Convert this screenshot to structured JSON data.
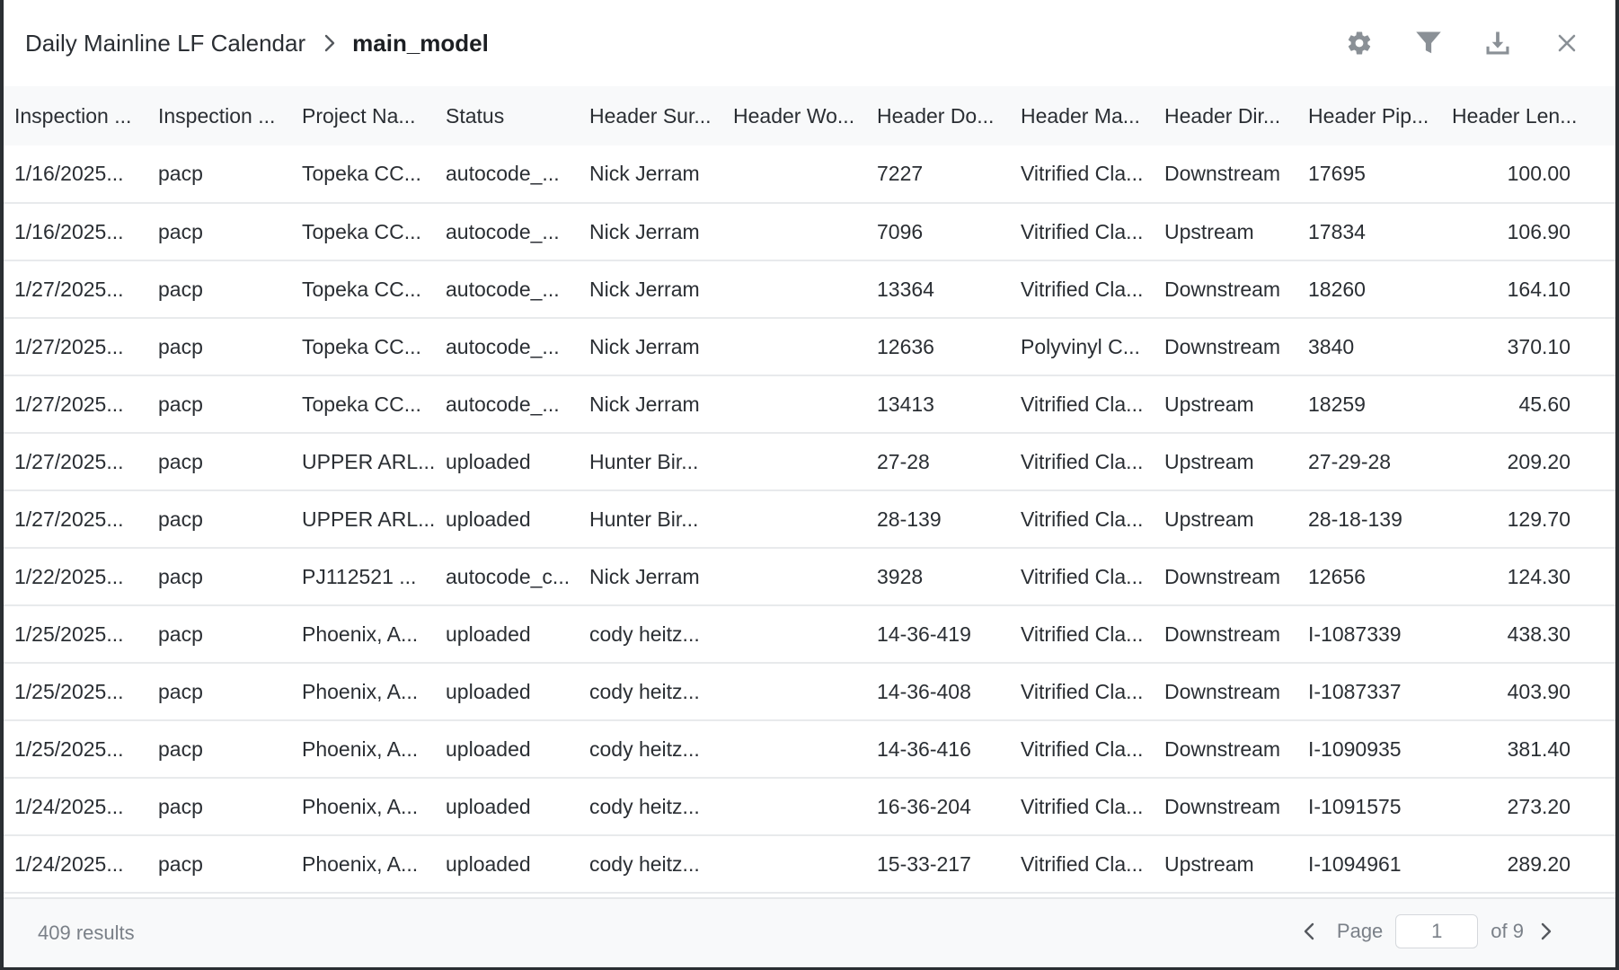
{
  "breadcrumb": {
    "parent": "Daily Mainline LF Calendar",
    "current": "main_model"
  },
  "icons": {
    "settings": "gear-icon",
    "filter": "filter-icon",
    "download": "download-icon",
    "close": "close-icon"
  },
  "table": {
    "columns": [
      "Inspection ...",
      "Inspection ...",
      "Project Na...",
      "Status",
      "Header Sur...",
      "Header Wo...",
      "Header Do...",
      "Header Ma...",
      "Header Dir...",
      "Header Pip...",
      "Header Len..."
    ],
    "rows": [
      [
        "1/16/2025...",
        "pacp",
        "Topeka CC...",
        "autocode_...",
        "Nick Jerram",
        "",
        "7227",
        "Vitrified Cla...",
        "Downstream",
        "17695",
        "100.00"
      ],
      [
        "1/16/2025...",
        "pacp",
        "Topeka CC...",
        "autocode_...",
        "Nick Jerram",
        "",
        "7096",
        "Vitrified Cla...",
        "Upstream",
        "17834",
        "106.90"
      ],
      [
        "1/27/2025...",
        "pacp",
        "Topeka CC...",
        "autocode_...",
        "Nick Jerram",
        "",
        "13364",
        "Vitrified Cla...",
        "Downstream",
        "18260",
        "164.10"
      ],
      [
        "1/27/2025...",
        "pacp",
        "Topeka CC...",
        "autocode_...",
        "Nick Jerram",
        "",
        "12636",
        "Polyvinyl C...",
        "Downstream",
        "3840",
        "370.10"
      ],
      [
        "1/27/2025...",
        "pacp",
        "Topeka CC...",
        "autocode_...",
        "Nick Jerram",
        "",
        "13413",
        "Vitrified Cla...",
        "Upstream",
        "18259",
        "45.60"
      ],
      [
        "1/27/2025...",
        "pacp",
        "UPPER ARL...",
        "uploaded",
        "Hunter Bir...",
        "",
        "27-28",
        "Vitrified Cla...",
        "Upstream",
        "27-29-28",
        "209.20"
      ],
      [
        "1/27/2025...",
        "pacp",
        "UPPER ARL...",
        "uploaded",
        "Hunter Bir...",
        "",
        "28-139",
        "Vitrified Cla...",
        "Upstream",
        "28-18-139",
        "129.70"
      ],
      [
        "1/22/2025...",
        "pacp",
        "PJ112521 ...",
        "autocode_c...",
        "Nick Jerram",
        "",
        "3928",
        "Vitrified Cla...",
        "Downstream",
        "12656",
        "124.30"
      ],
      [
        "1/25/2025...",
        "pacp",
        "Phoenix, A...",
        "uploaded",
        "cody heitz...",
        "",
        "14-36-419",
        "Vitrified Cla...",
        "Downstream",
        "I-1087339",
        "438.30"
      ],
      [
        "1/25/2025...",
        "pacp",
        "Phoenix, A...",
        "uploaded",
        "cody heitz...",
        "",
        "14-36-408",
        "Vitrified Cla...",
        "Downstream",
        "I-1087337",
        "403.90"
      ],
      [
        "1/25/2025...",
        "pacp",
        "Phoenix, A...",
        "uploaded",
        "cody heitz...",
        "",
        "14-36-416",
        "Vitrified Cla...",
        "Downstream",
        "I-1090935",
        "381.40"
      ],
      [
        "1/24/2025...",
        "pacp",
        "Phoenix, A...",
        "uploaded",
        "cody heitz...",
        "",
        "16-36-204",
        "Vitrified Cla...",
        "Downstream",
        "I-1091575",
        "273.20"
      ],
      [
        "1/24/2025...",
        "pacp",
        "Phoenix, A...",
        "uploaded",
        "cody heitz...",
        "",
        "15-33-217",
        "Vitrified Cla...",
        "Upstream",
        "I-1094961",
        "289.20"
      ]
    ]
  },
  "footer": {
    "results": "409 results",
    "page_label": "Page",
    "page_value": "1",
    "of_label": "of 9"
  }
}
